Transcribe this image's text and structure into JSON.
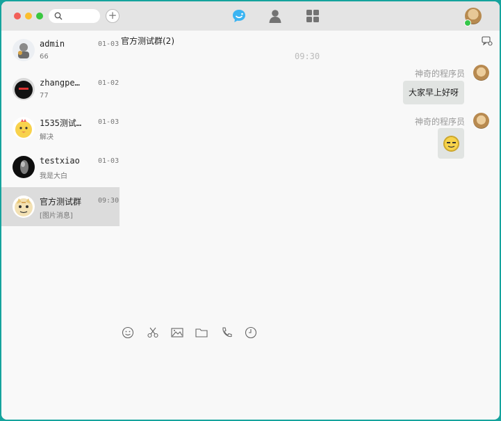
{
  "titlebar": {
    "window_controls": [
      "close",
      "minimize",
      "zoom"
    ],
    "search_icon": "search-icon",
    "add_label": "+",
    "nav": [
      "chat-icon",
      "contact-icon",
      "apps-grid-icon"
    ]
  },
  "sessions": [
    {
      "name": "admin",
      "message": "66",
      "time": "01-03",
      "active": false
    },
    {
      "name": "zhangpe…",
      "message": "77",
      "time": "01-02",
      "active": false
    },
    {
      "name": "1535测试…",
      "message": "解决",
      "time": "01-03",
      "active": false
    },
    {
      "name": "testxiao",
      "message": "我是大白",
      "time": "01-03",
      "active": false
    },
    {
      "name": "官方测试群",
      "message": "[图片消息]",
      "time": "09:30",
      "active": true
    }
  ],
  "chat": {
    "title": "官方测试群(2)",
    "time_divider": "09:30",
    "messages": [
      {
        "sender": "神奇的程序员",
        "type": "text",
        "text": "大家早上好呀"
      },
      {
        "sender": "神奇的程序员",
        "type": "image"
      }
    ]
  },
  "toolbar": [
    "emoji-icon",
    "scissors-icon",
    "image-icon",
    "folder-icon",
    "phone-icon",
    "history-icon"
  ],
  "colors": {
    "accent": "#3bb4f2",
    "background": "#15a39d",
    "active_session": "#dcdcdc",
    "bubble": "#e1e4e2"
  }
}
